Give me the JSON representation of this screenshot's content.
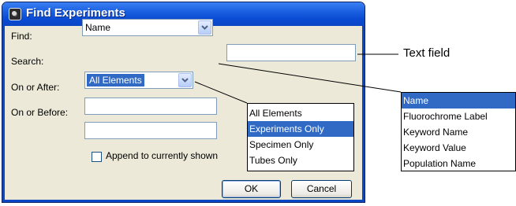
{
  "dialog": {
    "title": "Find Experiments",
    "find_label": "Find:",
    "find_value": "Name",
    "find_text": "",
    "search_label": "Search:",
    "search_value": "All Elements",
    "on_or_after_label": "On or After:",
    "on_or_after_value": "",
    "on_or_before_label": "On or Before:",
    "on_or_before_value": "",
    "append_label": "Append to currently shown",
    "append_checked": false,
    "ok_label": "OK",
    "cancel_label": "Cancel"
  },
  "search_dropdown": {
    "options": [
      "All Elements",
      "Experiments Only",
      "Specimen Only",
      "Tubes Only"
    ],
    "highlighted": "Experiments Only"
  },
  "find_dropdown": {
    "options": [
      "Name",
      "Fluorochrome Label",
      "Keyword Name",
      "Keyword Value",
      "Population Name"
    ],
    "highlighted": "Name"
  },
  "annotations": {
    "text_field": "Text field"
  },
  "colors": {
    "title_bar": "#0b46c4",
    "dialog_bg": "#ece9d8",
    "selection": "#316ac5"
  }
}
